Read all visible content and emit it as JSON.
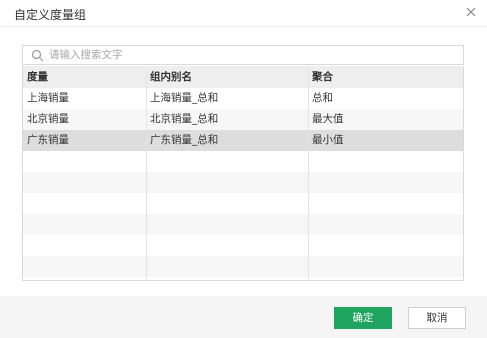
{
  "dialog": {
    "title": "自定义度量组",
    "close_icon": "close-icon"
  },
  "search": {
    "placeholder": "请输入搜索文字",
    "value": "",
    "icon": "search-icon"
  },
  "table": {
    "headers": [
      "度量",
      "组内别名",
      "聚合"
    ],
    "rows": [
      {
        "measure": "上海销量",
        "alias": "上海销量_总和",
        "aggregation": "总和"
      },
      {
        "measure": "北京销量",
        "alias": "北京销量_总和",
        "aggregation": "最大值"
      },
      {
        "measure": "广东销量",
        "alias": "广东销量_总和",
        "aggregation": "最小值",
        "selected": true
      }
    ]
  },
  "footer": {
    "ok_label": "确定",
    "cancel_label": "取消"
  },
  "colors": {
    "accent": "#1ea45e",
    "selected_row": "#dddddd",
    "header_bg": "#eeeeee"
  }
}
